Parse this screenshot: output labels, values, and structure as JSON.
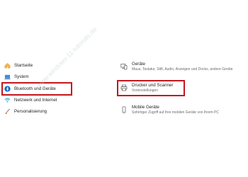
{
  "sidebar": {
    "items": [
      {
        "label": "Startseite",
        "icon": "home-icon"
      },
      {
        "label": "System",
        "icon": "laptop-icon"
      },
      {
        "label": "Bluetooth und Geräte",
        "icon": "bluetooth-icon"
      },
      {
        "label": "Netzwerk und Internet",
        "icon": "wifi-icon"
      },
      {
        "label": "Personalisierung",
        "icon": "brush-icon"
      }
    ]
  },
  "main": {
    "cards": [
      {
        "title": "Geräte",
        "subtitle": "Maus, Tastatur, Stift, Audio, Anzeigen und Docks, andere Geräte",
        "icon": "devices-icon"
      },
      {
        "title": "Drucker und Scanner",
        "subtitle": "Voreinstellungen",
        "icon": "printer-icon"
      },
      {
        "title": "Mobile Geräte",
        "subtitle": "Sofortiger Zugriff auf Ihre mobilen Geräte von Ihrem PC",
        "icon": "phone-icon"
      }
    ]
  },
  "watermark": {
    "text": "www.windows-11-tutorials.de"
  },
  "colors": {
    "highlight": "#c4161c",
    "accent": "#0067c0"
  }
}
